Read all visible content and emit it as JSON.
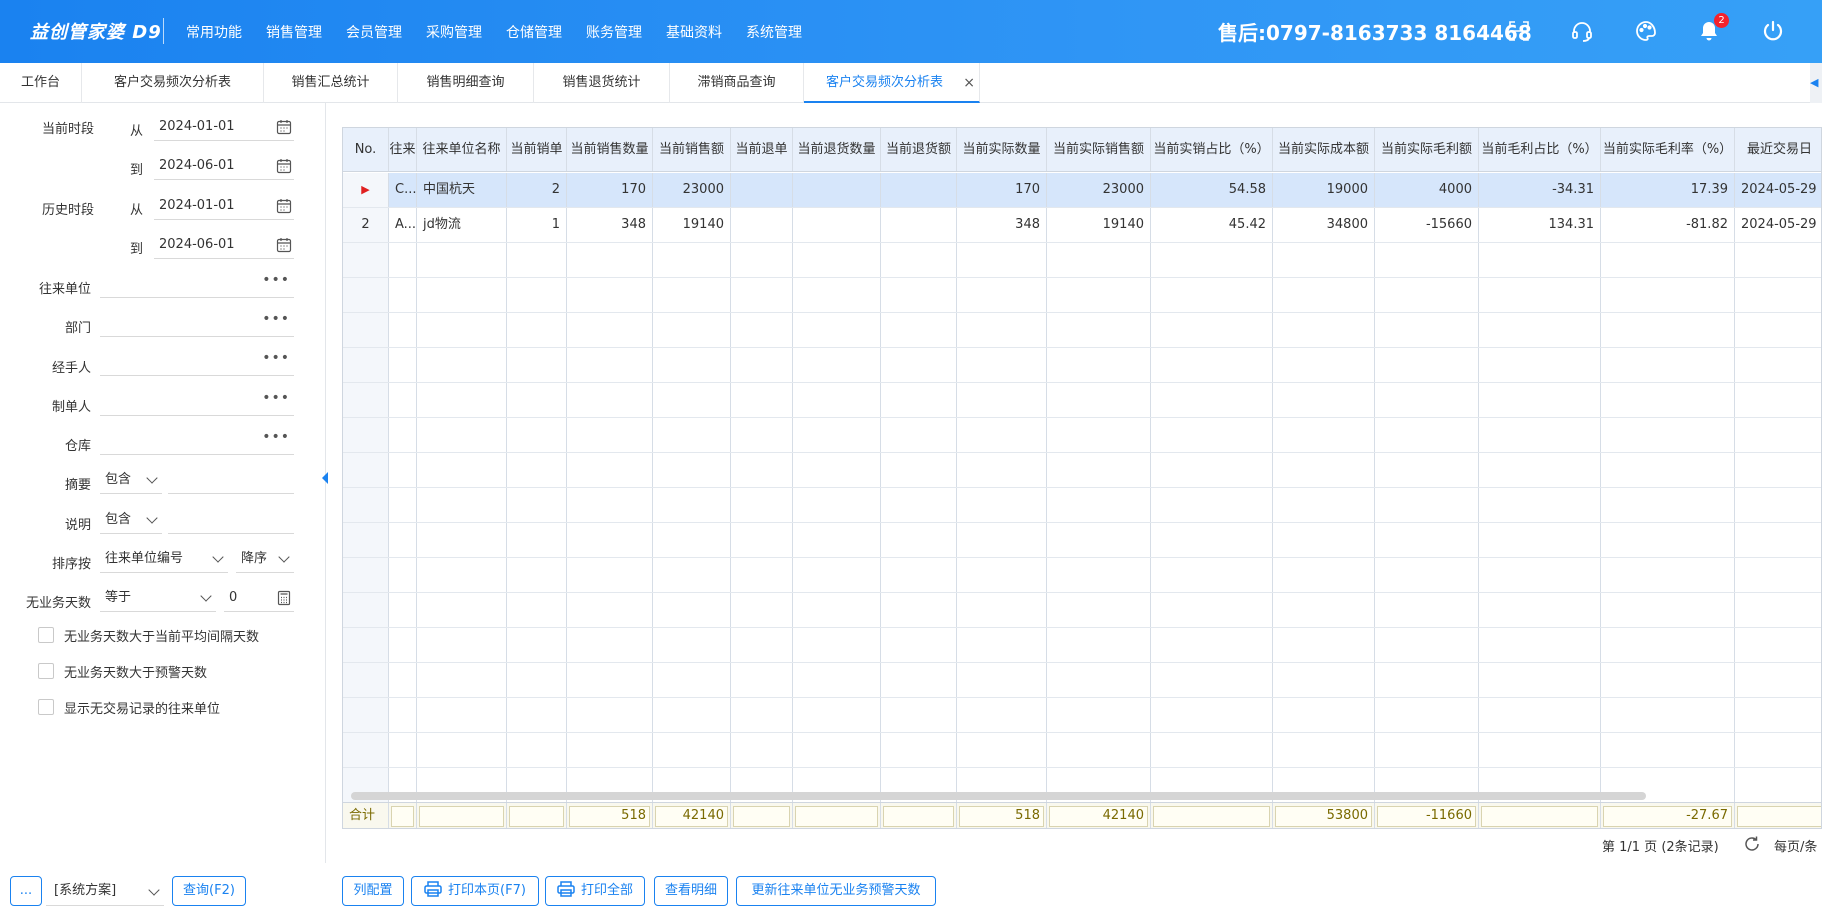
{
  "header": {
    "logo": "益创管家婆 D9",
    "nav": [
      "常用功能",
      "销售管理",
      "会员管理",
      "采购管理",
      "仓储管理",
      "账务管理",
      "基础资料",
      "系统管理"
    ],
    "hotline": "售后:0797-8163733  8164468",
    "notification_count": "2",
    "accent": "#1a82f0"
  },
  "tabs": [
    {
      "label": "工作台"
    },
    {
      "label": "客户交易频次分析表"
    },
    {
      "label": "销售汇总统计"
    },
    {
      "label": "销售明细查询"
    },
    {
      "label": "销售退货统计"
    },
    {
      "label": "滞销商品查询"
    },
    {
      "label": "客户交易频次分析表",
      "active": true,
      "close": "×"
    }
  ],
  "filters": {
    "current_period": {
      "label": "当前时段",
      "from_label": "从",
      "from": "2024-01-01",
      "to_label": "到",
      "to": "2024-06-01"
    },
    "history_period": {
      "label": "历史时段",
      "from_label": "从",
      "from": "2024-01-01",
      "to_label": "到",
      "to": "2024-06-01"
    },
    "partner": {
      "label": "往来单位",
      "value": ""
    },
    "department": {
      "label": "部门",
      "value": ""
    },
    "handler": {
      "label": "经手人",
      "value": ""
    },
    "creator": {
      "label": "制单人",
      "value": ""
    },
    "warehouse": {
      "label": "仓库",
      "value": ""
    },
    "summary": {
      "label": "摘要",
      "mode": "包含",
      "value": ""
    },
    "remark": {
      "label": "说明",
      "mode": "包含",
      "value": ""
    },
    "sort": {
      "label": "排序按",
      "field": "往来单位编号",
      "order": "降序"
    },
    "idle_days": {
      "label": "无业务天数",
      "op": "等于",
      "value": "0"
    },
    "checkboxes": [
      "无业务天数大于当前平均间隔天数",
      "无业务天数大于预警天数",
      "显示无交易记录的往来单位"
    ]
  },
  "grid": {
    "columns": [
      "No.",
      "往来",
      "往来单位名称",
      "当前销单",
      "当前销售数量",
      "当前销售额",
      "当前退单",
      "当前退货数量",
      "当前退货额",
      "当前实际数量",
      "当前实际销售额",
      "当前实销占比（%）",
      "当前实际成本额",
      "当前实际毛利额",
      "当前毛利占比（%）",
      "当前实际毛利率（%）",
      "最近交易日"
    ],
    "rows": [
      {
        "no": "▶",
        "code": "C...",
        "name": "中国杭天",
        "orders": "2",
        "qty": "170",
        "amount": "23000",
        "ret_orders": "",
        "ret_qty": "",
        "ret_amount": "",
        "real_qty": "170",
        "real_amount": "23000",
        "real_pct": "54.58",
        "cost": "19000",
        "profit": "4000",
        "profit_pct": "-34.31",
        "margin": "17.39",
        "last_date": "2024-05-29"
      },
      {
        "no": "2",
        "code": "A...",
        "name": "jd物流",
        "orders": "1",
        "qty": "348",
        "amount": "19140",
        "ret_orders": "",
        "ret_qty": "",
        "ret_amount": "",
        "real_qty": "348",
        "real_amount": "19140",
        "real_pct": "45.42",
        "cost": "34800",
        "profit": "-15660",
        "profit_pct": "134.31",
        "margin": "-81.82",
        "last_date": "2024-05-29"
      }
    ],
    "totals": {
      "label": "合计",
      "qty": "518",
      "amount": "42140",
      "real_qty": "518",
      "real_amount": "42140",
      "cost": "53800",
      "profit": "-11660",
      "margin": "-27.67"
    }
  },
  "pager": {
    "text": "第 1/1 页 (2条记录)",
    "per_page": "每页/条"
  },
  "bottom": {
    "more": "...",
    "scheme": "[系统方案]",
    "query": "查询(F2)",
    "col_config": "列配置",
    "print_page": "打印本页(F7)",
    "print_all": "打印全部",
    "view_detail": "查看明细",
    "update_warning": "更新往来单位无业务预警天数"
  }
}
